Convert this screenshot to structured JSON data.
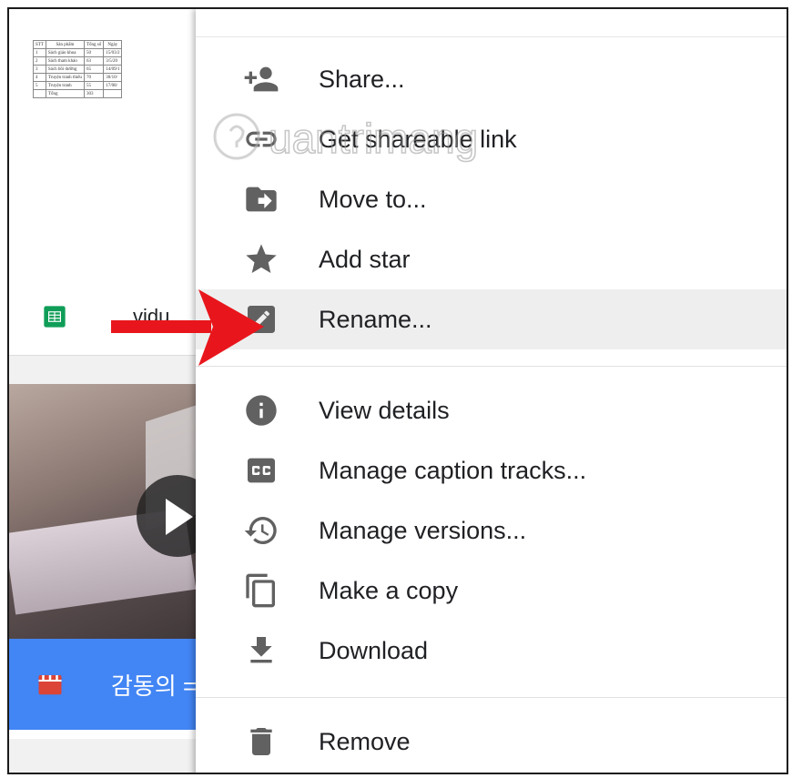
{
  "file_card": {
    "name": "vidu",
    "sheet_preview": {
      "headers": [
        "STT",
        "Sản phẩm",
        "Tổng số",
        "Ngày"
      ],
      "rows": [
        [
          "1",
          "Sách giáo khoa",
          "50",
          "15/03/2"
        ],
        [
          "2",
          "Sách tham khảo",
          "63",
          "3/5/20"
        ],
        [
          "3",
          "Sách bồi dưỡng",
          "65",
          "14/09/1"
        ],
        [
          "4",
          "Truyện tranh thiếu",
          "70",
          "30/10/"
        ],
        [
          "5",
          "Truyện tranh",
          "55",
          "17/08/"
        ]
      ],
      "total_label": "Tổng",
      "total_value": "303"
    }
  },
  "video_card": {
    "name": "감동의 ="
  },
  "menu": {
    "items": [
      {
        "key": "share",
        "label": "Share..."
      },
      {
        "key": "get-shareable-link",
        "label": "Get shareable link"
      },
      {
        "key": "move-to",
        "label": "Move to..."
      },
      {
        "key": "add-star",
        "label": "Add star"
      },
      {
        "key": "rename",
        "label": "Rename...",
        "active": true
      },
      {
        "key": "view-details",
        "label": "View details"
      },
      {
        "key": "manage-caption-tracks",
        "label": "Manage caption tracks..."
      },
      {
        "key": "manage-versions",
        "label": "Manage versions..."
      },
      {
        "key": "make-a-copy",
        "label": "Make a copy"
      },
      {
        "key": "download",
        "label": "Download"
      },
      {
        "key": "remove",
        "label": "Remove"
      }
    ]
  },
  "watermark": {
    "text": "uantrimang"
  },
  "colors": {
    "icon_gray": "#616161",
    "active_bg": "#eeeeee",
    "arrow_red": "#e8161c",
    "sheets_green": "#0f9d58",
    "video_bar_blue": "#4285f4",
    "clapper_red": "#db4437"
  }
}
